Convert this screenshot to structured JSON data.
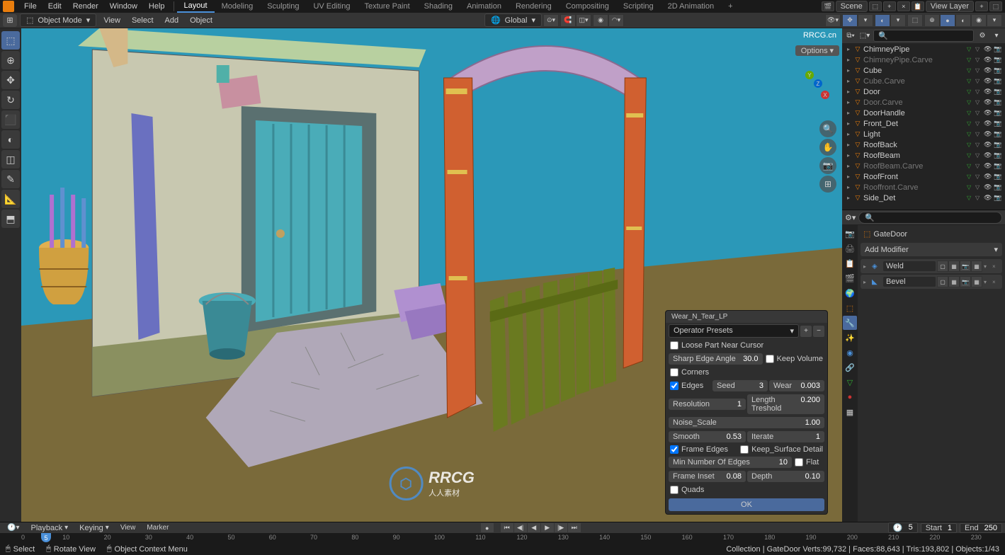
{
  "watermark": "RRCG.cn",
  "logo_watermark": {
    "big": "RRCG",
    "sub": "人人素材"
  },
  "top_menu": {
    "items": [
      "File",
      "Edit",
      "Render",
      "Window",
      "Help"
    ],
    "tabs": [
      "Layout",
      "Modeling",
      "Sculpting",
      "UV Editing",
      "Texture Paint",
      "Shading",
      "Animation",
      "Rendering",
      "Compositing",
      "Scripting",
      "2D Animation",
      "+"
    ],
    "active_tab": 0,
    "scene_label": "Scene",
    "viewlayer_label": "View Layer"
  },
  "toolbar2": {
    "mode": "Object Mode",
    "menus": [
      "View",
      "Select",
      "Add",
      "Object"
    ],
    "orientation": "Global",
    "options_btn": "Options"
  },
  "left_tools": [
    "⬚",
    "⊕",
    "✥",
    "↻",
    "⬛",
    "◐",
    "◫",
    "✎",
    "📐",
    "⬒"
  ],
  "nav_axes": {
    "x": "X",
    "y": "Y",
    "z": "Z"
  },
  "operator": {
    "title": "Wear_N_Tear_LP",
    "presets": "Operator Presets",
    "loose_part": {
      "label": "Loose Part Near Cursor",
      "checked": false
    },
    "sharp_edge": {
      "label": "Sharp Edge Angle",
      "value": "30.0"
    },
    "keep_volume": {
      "label": "Keep Volume",
      "checked": false
    },
    "corners": {
      "label": "Corners",
      "checked": false
    },
    "edges": {
      "label": "Edges",
      "checked": true
    },
    "seed": {
      "label": "Seed",
      "value": "3"
    },
    "wear": {
      "label": "Wear",
      "value": "0.003"
    },
    "resolution": {
      "label": "Resolution",
      "value": "1"
    },
    "length_treshold": {
      "label": "Length Treshold",
      "value": "0.200"
    },
    "noise_scale": {
      "label": "Noise_Scale",
      "value": "1.00"
    },
    "smooth": {
      "label": "Smooth",
      "value": "0.53"
    },
    "iterate": {
      "label": "Iterate",
      "value": "1"
    },
    "frame_edges": {
      "label": "Frame Edges",
      "checked": true
    },
    "keep_surface": {
      "label": "Keep_Surface Detail",
      "checked": false
    },
    "min_edges": {
      "label": "Min Number Of Edges",
      "value": "10"
    },
    "flat": {
      "label": "Flat",
      "checked": false
    },
    "frame_inset": {
      "label": "Frame Inset",
      "value": "0.08"
    },
    "depth": {
      "label": "Depth",
      "value": "0.10"
    },
    "quads": {
      "label": "Quads",
      "checked": false
    },
    "ok": "OK"
  },
  "outliner": {
    "items": [
      {
        "name": "ChimneyPipe",
        "dim": false
      },
      {
        "name": "ChimneyPipe.Carve",
        "dim": true
      },
      {
        "name": "Cube",
        "dim": false
      },
      {
        "name": "Cube.Carve",
        "dim": true
      },
      {
        "name": "Door",
        "dim": false
      },
      {
        "name": "Door.Carve",
        "dim": true
      },
      {
        "name": "DoorHandle",
        "dim": false
      },
      {
        "name": "Front_Det",
        "dim": false
      },
      {
        "name": "Light",
        "dim": false
      },
      {
        "name": "RoofBack",
        "dim": false
      },
      {
        "name": "RoofBeam",
        "dim": false
      },
      {
        "name": "RoofBeam.Carve",
        "dim": true
      },
      {
        "name": "RoofFront",
        "dim": false
      },
      {
        "name": "Rooffront.Carve",
        "dim": true
      },
      {
        "name": "Side_Det",
        "dim": false
      }
    ]
  },
  "properties": {
    "object_name": "GateDoor",
    "add_modifier": "Add Modifier",
    "modifiers": [
      {
        "name": "Weld"
      },
      {
        "name": "Bevel"
      }
    ]
  },
  "timeline": {
    "playback": "Playback",
    "keying": "Keying",
    "menus": [
      "View",
      "Marker"
    ],
    "current": "5",
    "start_label": "Start",
    "start": "1",
    "end_label": "End",
    "end": "250",
    "ticks": [
      "0",
      "10",
      "20",
      "30",
      "40",
      "50",
      "60",
      "70",
      "80",
      "90",
      "100",
      "110",
      "120",
      "130",
      "140",
      "150",
      "160",
      "170",
      "180",
      "190",
      "200",
      "210",
      "220",
      "230"
    ]
  },
  "status": {
    "select": "Select",
    "rotate": "Rotate View",
    "context": "Object Context Menu",
    "stats": "Collection | GateDoor  Verts:99,732 | Faces:88,643 | Tris:193,802 | Objects:1/43"
  }
}
